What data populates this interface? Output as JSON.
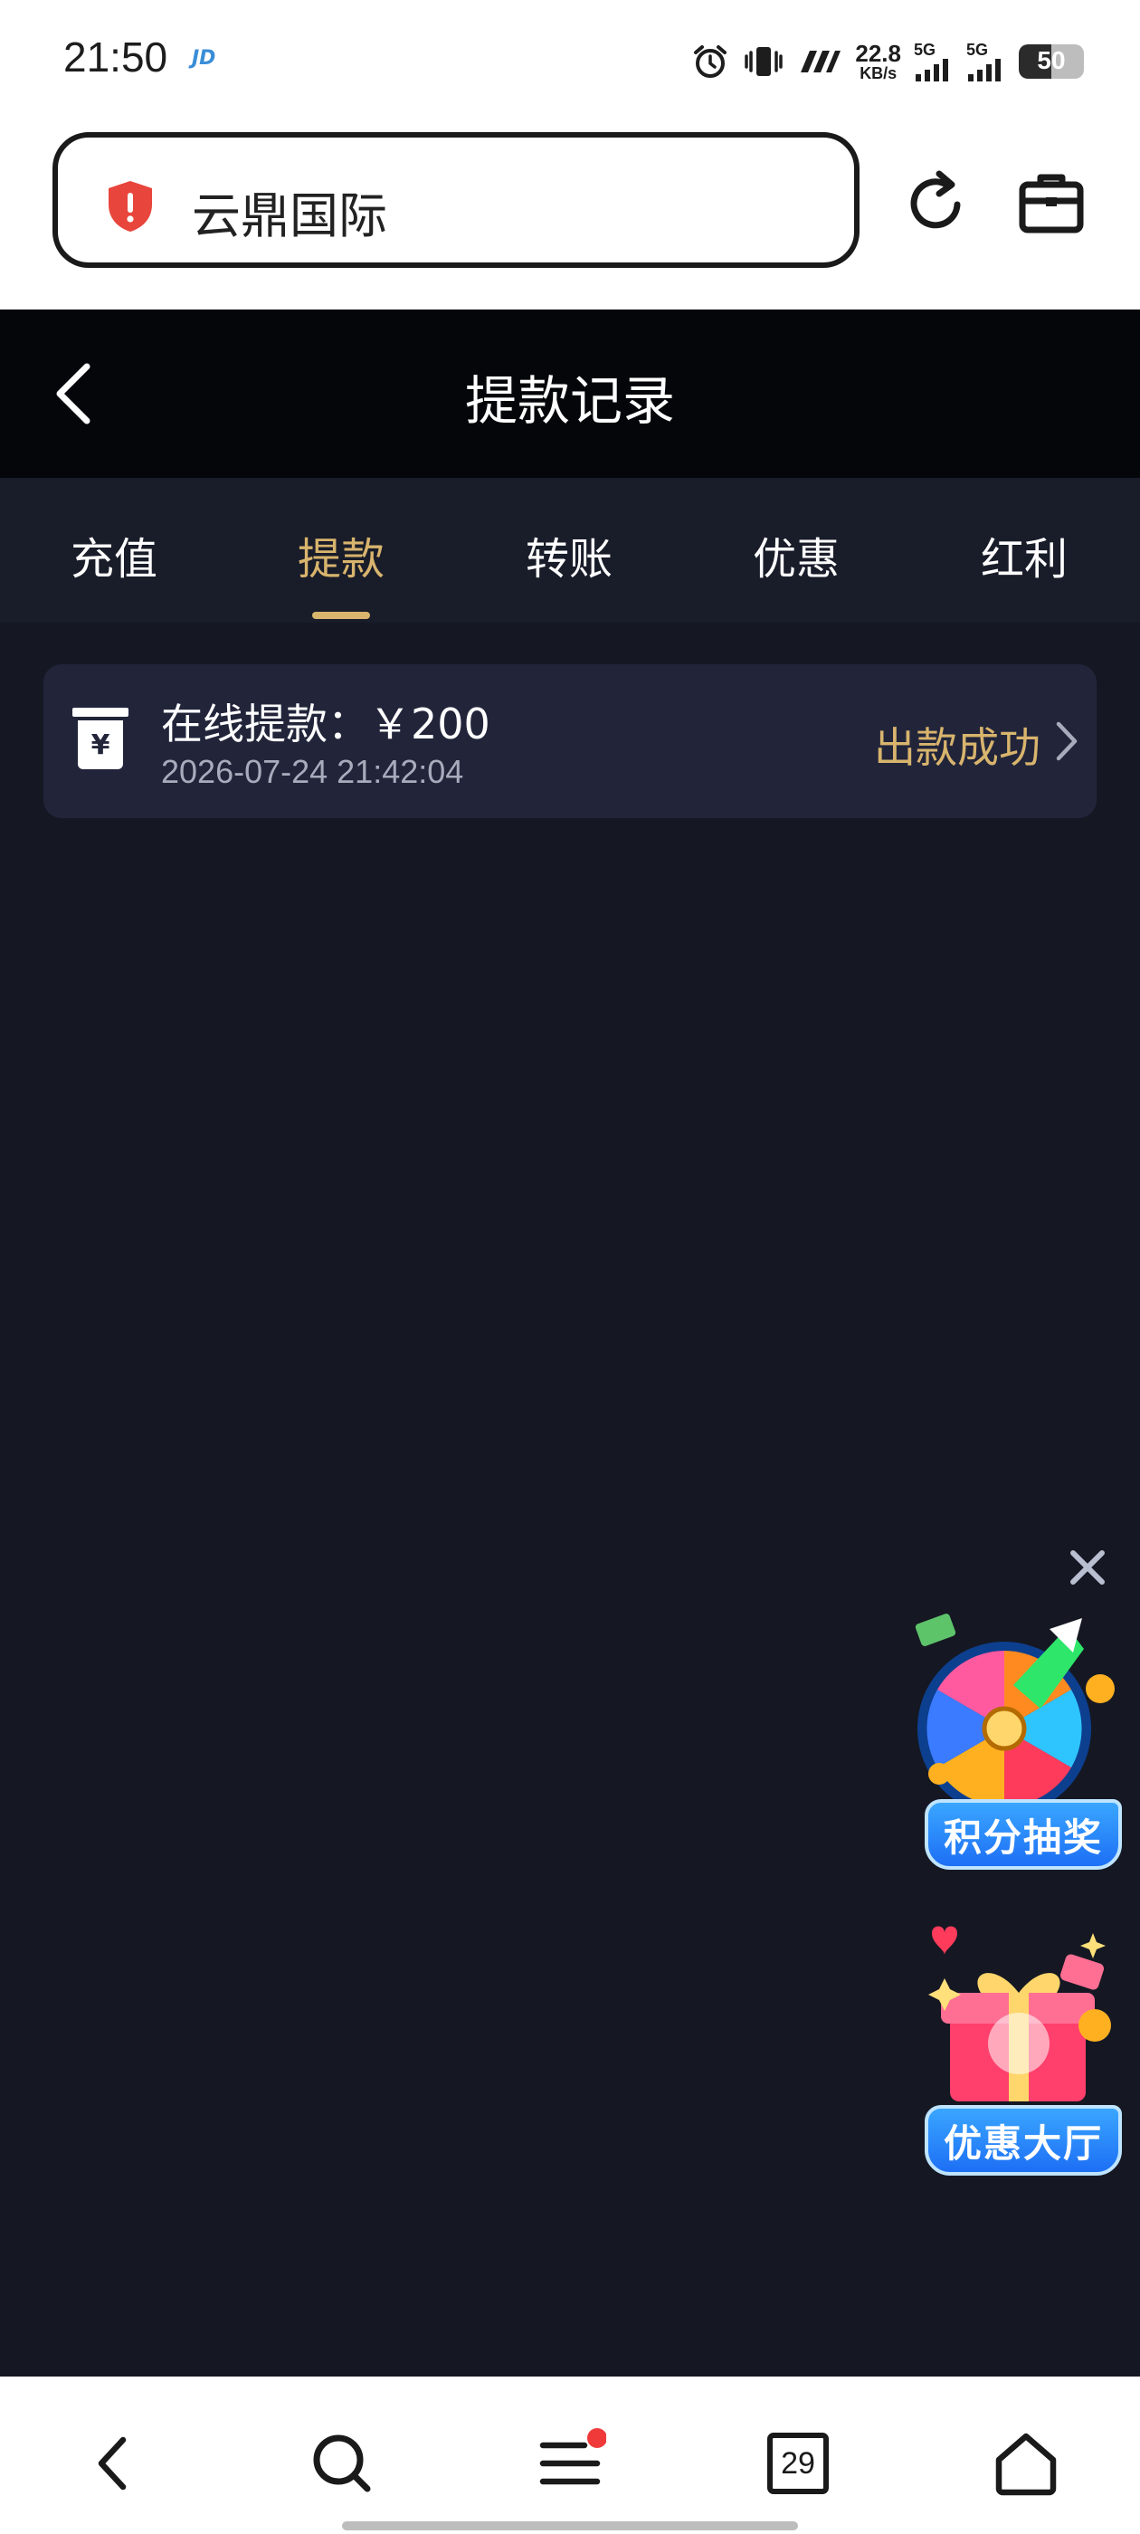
{
  "status_bar": {
    "time": "21:50",
    "jd_badge": "JD",
    "net_speed_value": "22.8",
    "net_speed_unit": "KB/s",
    "signal_1_label": "5G",
    "signal_2_label": "5G",
    "battery_level": "50",
    "icons": [
      "alarm-icon",
      "vibrate-icon",
      "hd-icon",
      "signal-icon",
      "battery-icon"
    ]
  },
  "browser": {
    "url_text": "云鼎国际",
    "icons": [
      "shield-alert-icon",
      "reload-icon",
      "toolbox-icon"
    ]
  },
  "header": {
    "title": "提款记录"
  },
  "tabs": [
    {
      "label": "充值",
      "active": false
    },
    {
      "label": "提款",
      "active": true
    },
    {
      "label": "转账",
      "active": false
    },
    {
      "label": "优惠",
      "active": false
    },
    {
      "label": "红利",
      "active": false
    }
  ],
  "records": [
    {
      "title": "在线提款：￥200",
      "time": "2026-07-24 21:42:04",
      "status": "出款成功"
    }
  ],
  "floating": {
    "lottery_label": "积分抽奖",
    "offers_label": "优惠大厅"
  },
  "bottom_nav": {
    "tab_count": "29",
    "items": [
      "back-icon",
      "search-icon",
      "menu-icon",
      "tabs-icon",
      "home-icon"
    ]
  },
  "colors": {
    "accent_gold": "#d8b46d",
    "page_bg": "#151823",
    "card_bg": "#22253a",
    "tab_bar_bg": "#191c29",
    "header_bg": "#05060a",
    "shield_red": "#e8453c",
    "promo_blue": "#1d6ff5",
    "notify_red": "#f03a3a"
  }
}
